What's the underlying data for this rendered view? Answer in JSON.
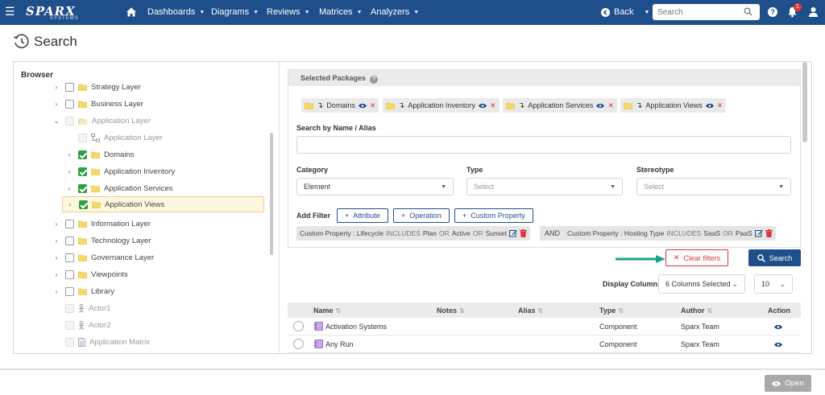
{
  "topbar": {
    "logo_main": "SPARX",
    "logo_sub": "SYSTEMS",
    "menu": [
      {
        "label": "Dashboards"
      },
      {
        "label": "Diagrams"
      },
      {
        "label": "Reviews"
      },
      {
        "label": "Matrices"
      },
      {
        "label": "Analyzers"
      }
    ],
    "back_label": "Back",
    "search_placeholder": "Search",
    "help_label": "?",
    "notification_count": "1",
    "brand_color": "#1f4f8b"
  },
  "page": {
    "title": "Search"
  },
  "browser": {
    "title": "Browser",
    "nodes": [
      {
        "label": "Strategy Layer"
      },
      {
        "label": "Business Layer"
      },
      {
        "label": "Application Layer"
      },
      {
        "label": "Application Layer"
      },
      {
        "label": "Domains"
      },
      {
        "label": "Application Inventory"
      },
      {
        "label": "Application Services"
      },
      {
        "label": "Application Views"
      },
      {
        "label": "Information Layer"
      },
      {
        "label": "Technology Layer"
      },
      {
        "label": "Governance Layer"
      },
      {
        "label": "Viewpoints"
      },
      {
        "label": "Library"
      },
      {
        "label": "Actor1"
      },
      {
        "label": "Actor2"
      },
      {
        "label": "Application Matrix"
      }
    ]
  },
  "form": {
    "selected_packages_label": "Selected Packages",
    "packages": [
      {
        "label": "Domains"
      },
      {
        "label": "Application Inventory"
      },
      {
        "label": "Application Services"
      },
      {
        "label": "Application Views"
      }
    ],
    "name_alias_label": "Search by Name / Alias",
    "name_alias_value": "",
    "category_label": "Category",
    "category_value": "Element",
    "type_label": "Type",
    "type_placeholder": "Select",
    "stereotype_label": "Stereotype",
    "stereotype_placeholder": "Select",
    "add_filter_label": "Add Filter",
    "filter_buttons": [
      {
        "label": "Attribute"
      },
      {
        "label": "Operation"
      },
      {
        "label": "Custom Property"
      }
    ],
    "conditions": [
      {
        "prefix": "Custom Property : Lifecycle",
        "op": "INCLUDES",
        "v1": "Plan",
        "or1": "OR",
        "v2": "Active",
        "or2": "OR",
        "v3": "Sunset"
      },
      {
        "prefix": "Custom Property : Hosting Type",
        "op": "INCLUDES",
        "v1": "SaaS",
        "or1": "OR",
        "v2": "PaaS"
      }
    ],
    "and_label": "AND"
  },
  "actions": {
    "clear_label": "Clear filters",
    "search_label": "Search",
    "display_columns_label": "Display Columns:",
    "display_columns_value": "6 Columns Selected",
    "page_size_value": "10"
  },
  "table": {
    "headers": {
      "name": "Name",
      "notes": "Notes",
      "alias": "Alias",
      "type": "Type",
      "author": "Author",
      "action": "Action"
    },
    "sort_glyph": "⇅",
    "rows": [
      {
        "name": "Activation Systems",
        "notes": "",
        "alias": "",
        "type": "Component",
        "author": "Sparx Team"
      },
      {
        "name": "Any Run",
        "notes": "",
        "alias": "",
        "type": "Component",
        "author": "Sparx Team"
      }
    ]
  },
  "footer": {
    "open_label": "Open"
  }
}
